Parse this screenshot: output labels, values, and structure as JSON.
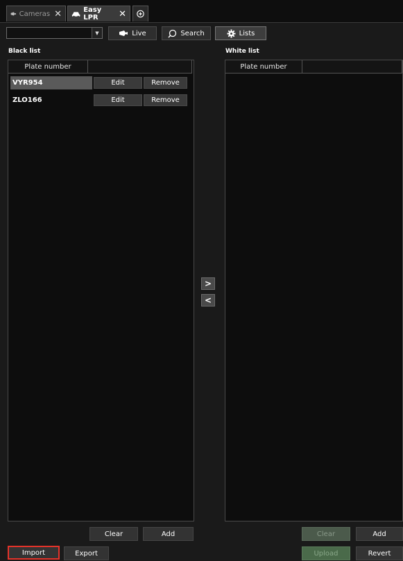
{
  "tabs": [
    {
      "label": "Cameras",
      "icon": "camera-icon",
      "close": "✕"
    },
    {
      "label": "Easy LPR",
      "icon": "car-icon",
      "close": "✕"
    }
  ],
  "add_tab_icon": "plus-circle-icon",
  "toolbar": {
    "dropdown_value": "",
    "live_label": "Live",
    "search_label": "Search",
    "lists_label": "Lists"
  },
  "black_list": {
    "title": "Black list",
    "column": "Plate number",
    "rows": [
      {
        "plate": "VYR954",
        "edit": "Edit",
        "remove": "Remove"
      },
      {
        "plate": "ZLO166",
        "edit": "Edit",
        "remove": "Remove"
      }
    ],
    "clear_label": "Clear",
    "add_label": "Add"
  },
  "white_list": {
    "title": "White list",
    "column": "Plate number",
    "clear_label": "Clear",
    "add_label": "Add"
  },
  "move_right": ">",
  "move_left": "<",
  "bottom": {
    "import_label": "Import",
    "export_label": "Export",
    "upload_label": "Upload",
    "revert_label": "Revert"
  },
  "colors": {
    "highlight": "#e5332a",
    "background": "#1a1a1a"
  }
}
